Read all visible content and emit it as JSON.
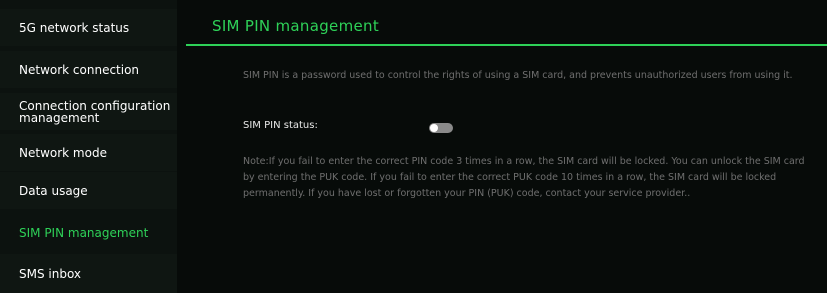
{
  "sidebar": {
    "items": [
      {
        "label": "5G network status"
      },
      {
        "label": "Network connection"
      },
      {
        "label": "Connection configuration management"
      },
      {
        "label": "Network mode"
      },
      {
        "label": "Data usage"
      },
      {
        "label": "SIM PIN management",
        "active": true
      },
      {
        "label": "SMS inbox"
      }
    ]
  },
  "main": {
    "title": "SIM PIN management",
    "description": "SIM PIN is a password used to control the rights of using a SIM card, and prevents unauthorized users from using it.",
    "status_label": "SIM PIN status:",
    "status_toggle": {
      "enabled": false
    },
    "note": "Note:If you fail to enter the correct PIN code 3 times in a row, the SIM card will be locked. You can unlock the SIM card by entering the PUK code. If you fail to enter the correct PUK code 10 times in a row, the SIM card will be locked permanently. If you have lost or forgotten your PIN (PUK) code, contact your service provider.."
  },
  "colors": {
    "accent": "#2ed158",
    "background": "#070b09",
    "sidebar_bg": "#0f1612",
    "muted_text": "#6f6f6f"
  }
}
